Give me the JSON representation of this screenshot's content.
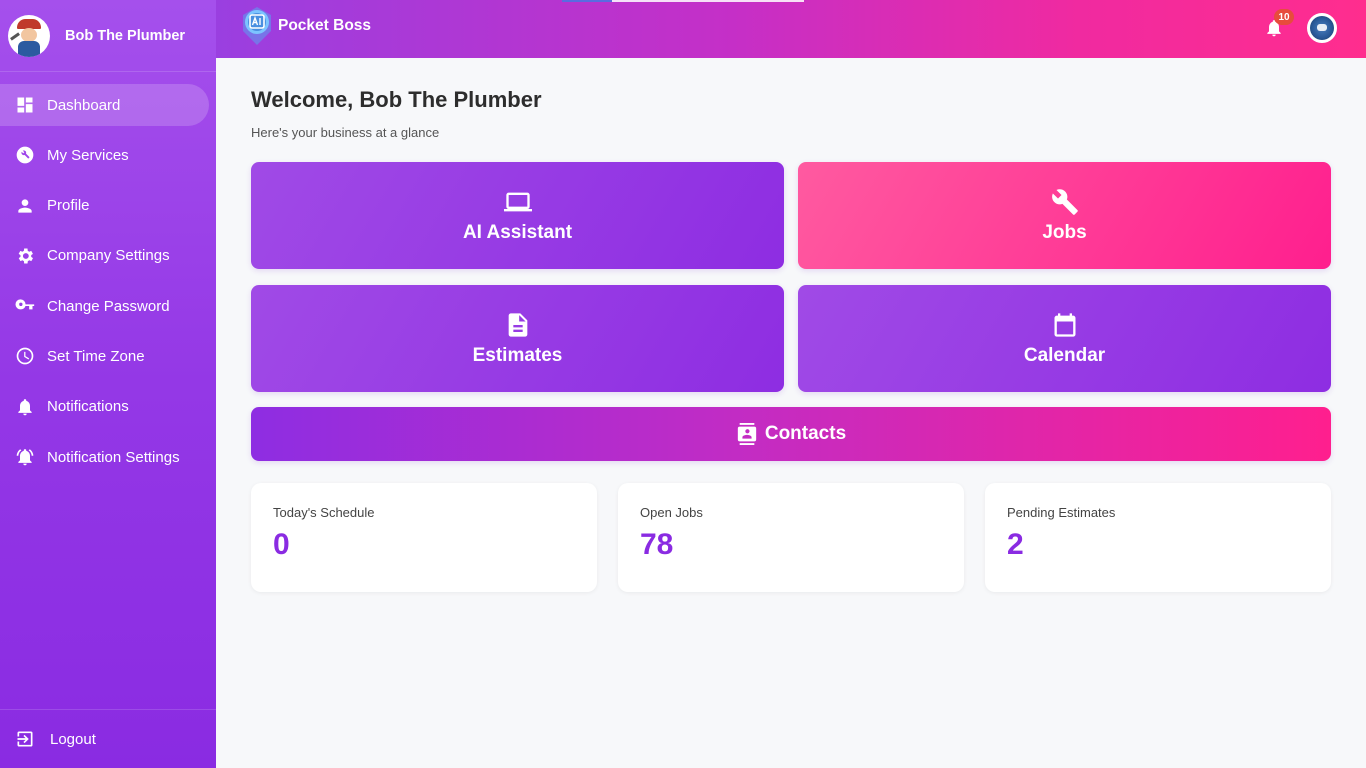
{
  "sidebar": {
    "company_name": "Bob The Plumber",
    "items": [
      {
        "label": "Dashboard",
        "icon": "dashboard-icon",
        "active": true
      },
      {
        "label": "My Services",
        "icon": "wrench-icon"
      },
      {
        "label": "Profile",
        "icon": "person-icon"
      },
      {
        "label": "Company Settings",
        "icon": "gear-icon"
      },
      {
        "label": "Change Password",
        "icon": "key-icon"
      },
      {
        "label": "Set Time Zone",
        "icon": "clock-icon"
      },
      {
        "label": "Notifications",
        "icon": "bell-icon"
      },
      {
        "label": "Notification Settings",
        "icon": "bell-ring-icon"
      }
    ],
    "logout_label": "Logout"
  },
  "topbar": {
    "brand_name": "Pocket Boss",
    "notification_count": "10"
  },
  "main": {
    "welcome": "Welcome, Bob The Plumber",
    "subtitle": "Here's your business at a glance",
    "cards": {
      "ai": "AI Assistant",
      "jobs": "Jobs",
      "estimates": "Estimates",
      "calendar": "Calendar",
      "contacts": "Contacts"
    },
    "stats": [
      {
        "label": "Today's Schedule",
        "value": "0"
      },
      {
        "label": "Open Jobs",
        "value": "78"
      },
      {
        "label": "Pending Estimates",
        "value": "2"
      }
    ]
  },
  "colors": {
    "sidebar": "#9438e6",
    "accent_purple": "#8a2be2",
    "accent_pink": "#ff1f8e",
    "badge": "#e74c3c",
    "background": "#f7f8fa"
  }
}
